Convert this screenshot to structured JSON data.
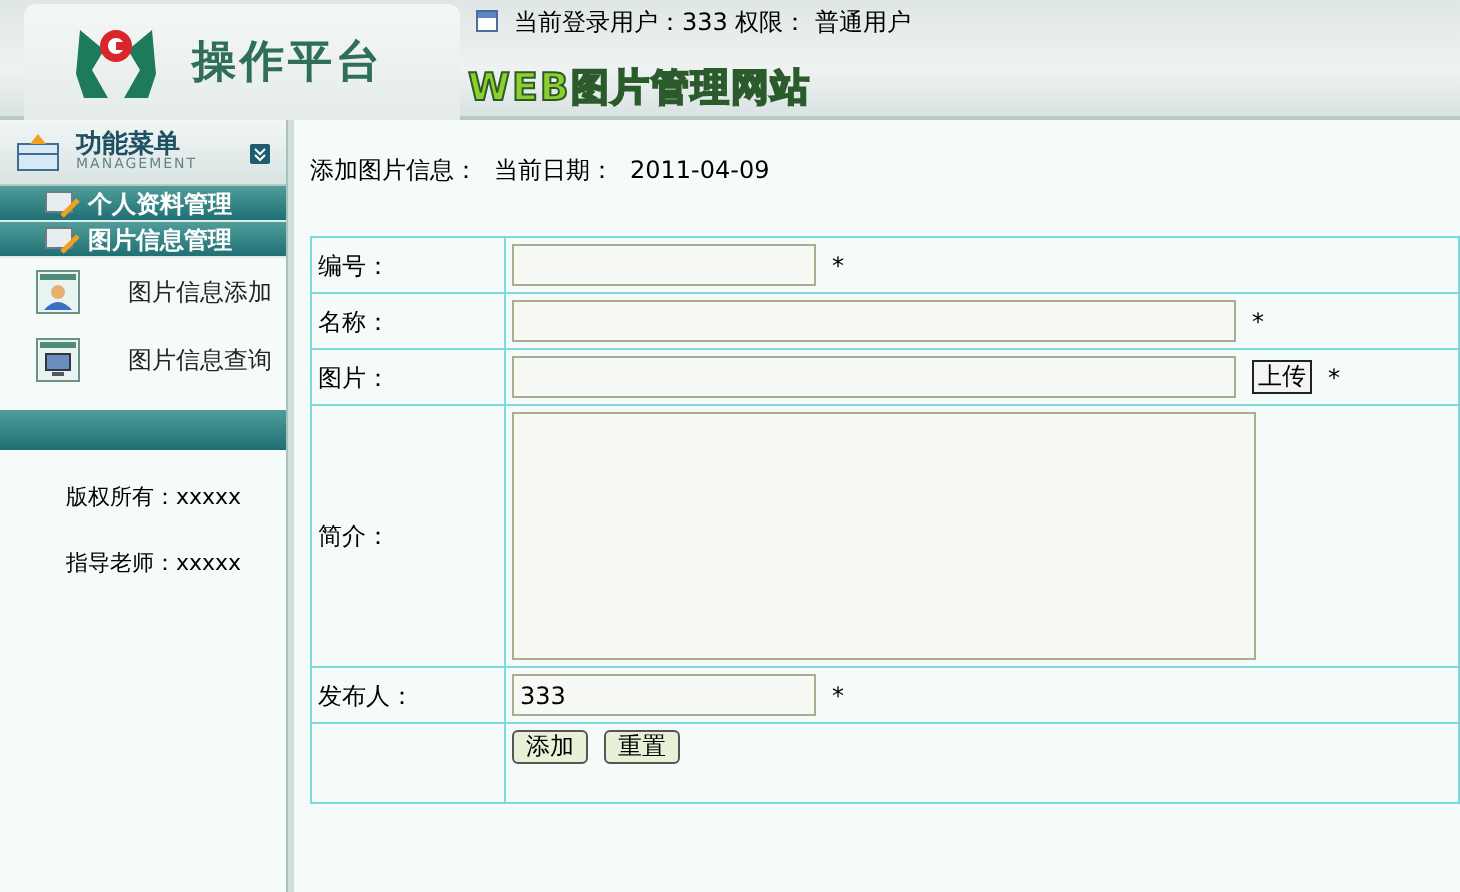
{
  "header": {
    "logo_text": "操作平台",
    "user_info": "当前登录用户：333 权限： 普通用户",
    "site_title": "WEB图片管理网站"
  },
  "sidebar": {
    "menu_title": "功能菜单",
    "menu_subtitle": "MANAGEMENT",
    "sections": [
      {
        "label": "个人资料管理"
      },
      {
        "label": "图片信息管理",
        "items": [
          {
            "label": "图片信息添加",
            "kind": "add"
          },
          {
            "label": "图片信息查询",
            "kind": "query"
          }
        ]
      }
    ],
    "footer": [
      "版权所有：xxxxx",
      "指导老师：xxxxx"
    ]
  },
  "page": {
    "heading": "添加图片信息：",
    "date_label": "当前日期：",
    "date": "2011-04-09"
  },
  "form": {
    "rows": [
      {
        "label": "编号：",
        "kind": "short",
        "value": "",
        "required": "*"
      },
      {
        "label": "名称：",
        "kind": "long",
        "value": "",
        "required": "*"
      },
      {
        "label": "图片：",
        "kind": "upload",
        "value": "",
        "button": "上传",
        "required": "*"
      },
      {
        "label": "简介：",
        "kind": "textarea",
        "value": ""
      },
      {
        "label": "发布人：",
        "kind": "short",
        "value": "333",
        "required": "*"
      }
    ],
    "buttons": [
      "添加",
      "重置"
    ]
  }
}
